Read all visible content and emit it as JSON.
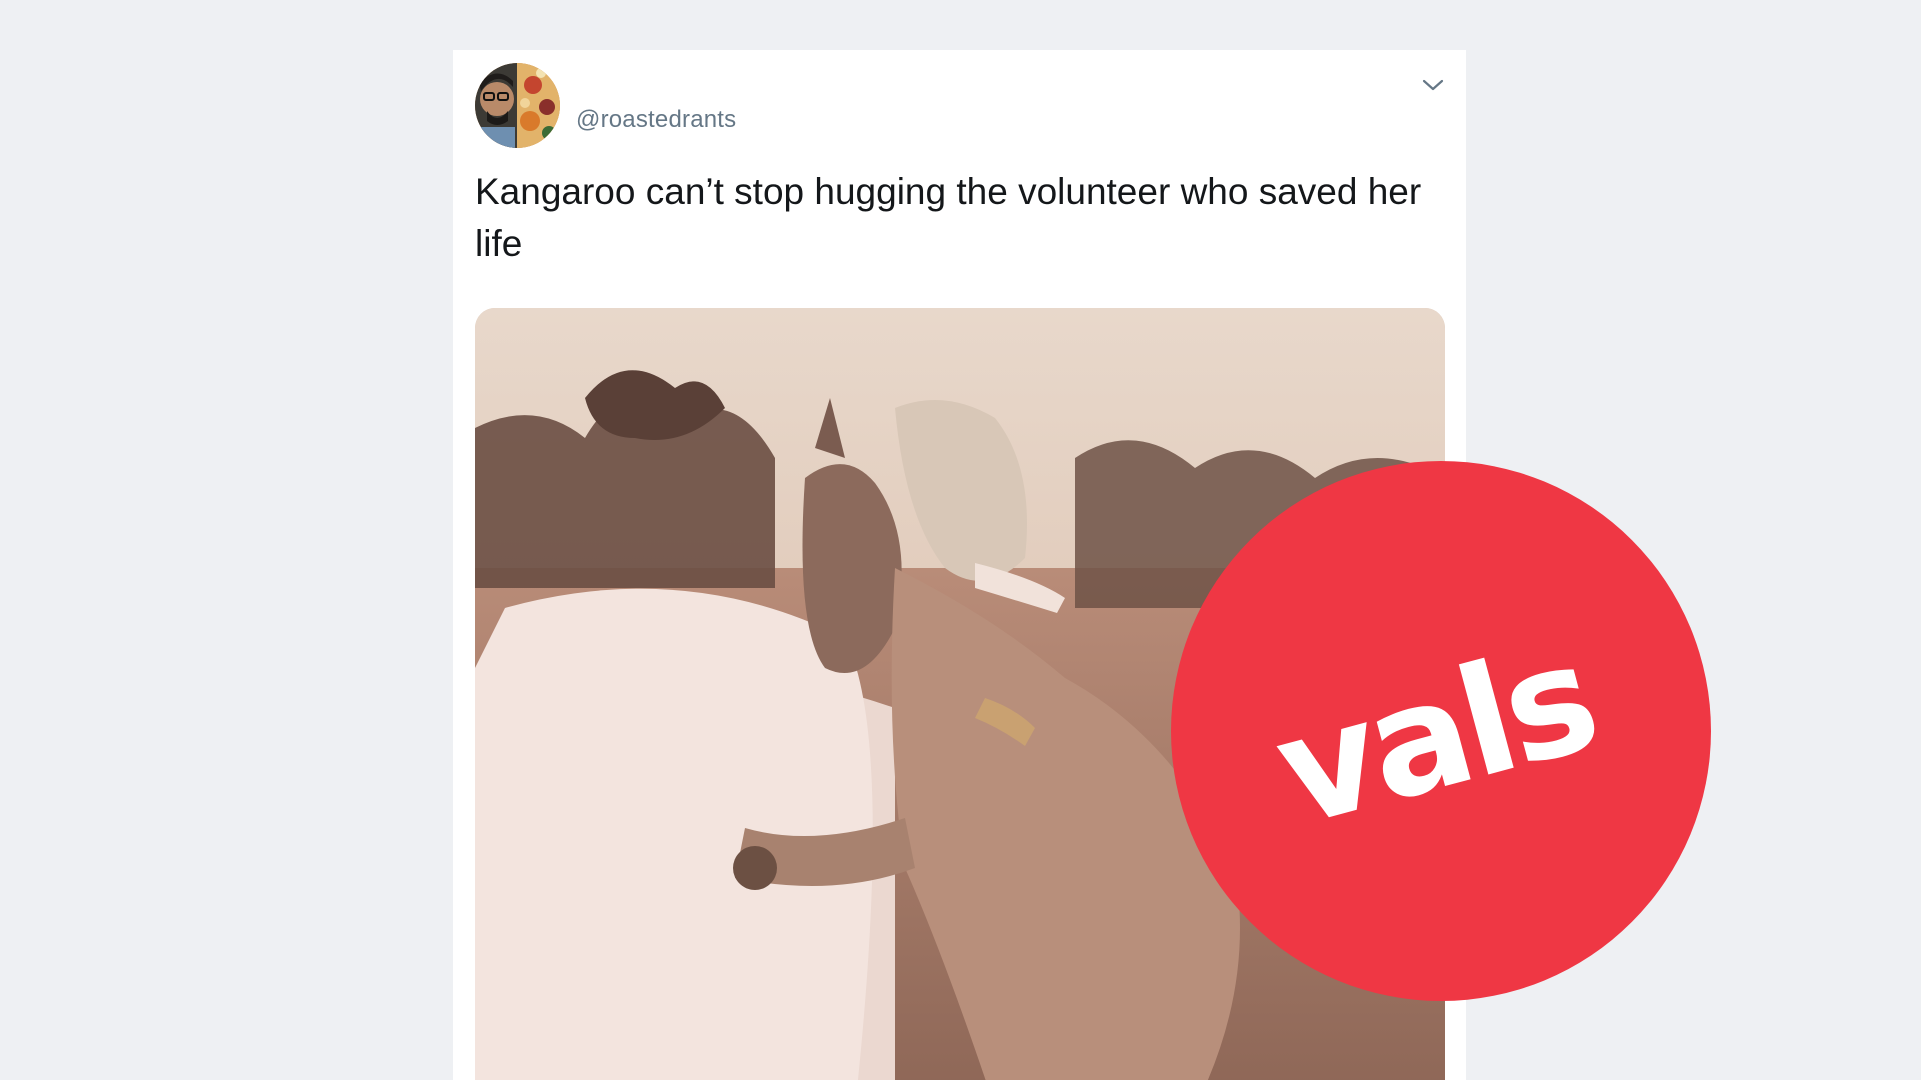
{
  "tweet": {
    "handle": "@roastedrants",
    "text": "Kangaroo can’t stop hugging the volunteer who saved her life",
    "menu_icon": "chevron-down-icon",
    "avatar_icon": "user-avatar",
    "media_description_icon": "embedded-photo"
  },
  "stamp": {
    "label": "vals",
    "color": "#ef3744"
  },
  "colors": {
    "page_background": "#eef0f3",
    "card_background": "#ffffff",
    "handle_text": "#657786",
    "body_text": "#14171a"
  }
}
